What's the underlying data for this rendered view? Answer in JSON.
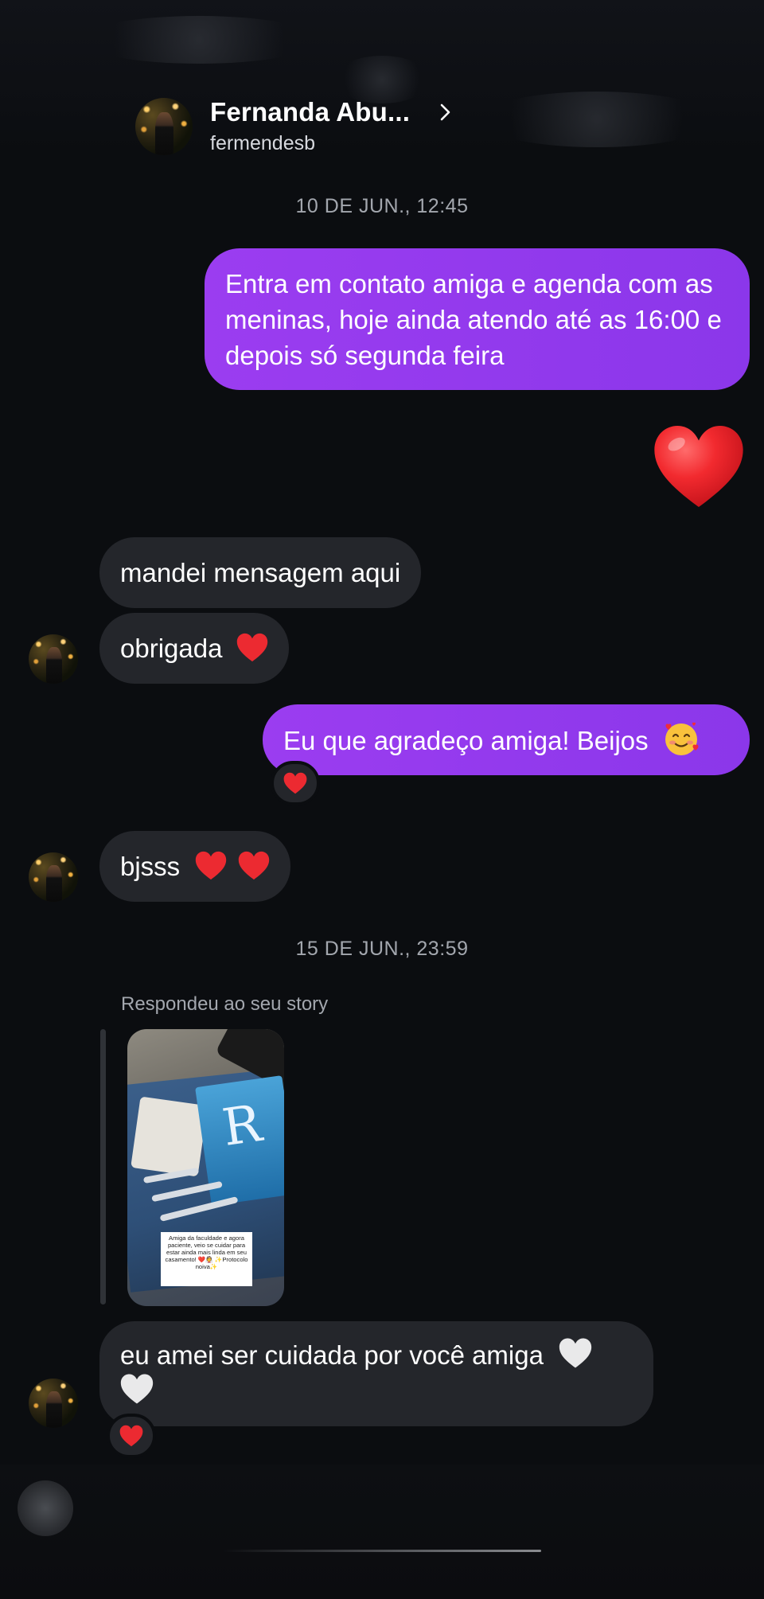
{
  "header": {
    "name": "Fernanda Abu...",
    "handle": "fermendesb"
  },
  "messages": {
    "date1": "10 DE JUN., 12:45",
    "out1": "Entra em contato amiga e agenda com as meninas, hoje ainda atendo até as 16:00 e depois só segunda feira",
    "in1": "mandei mensagem aqui",
    "in2": "obrigada",
    "out2": "Eu que agradeço amiga! Beijos",
    "in3": "bjsss",
    "date2": "15 DE JUN., 23:59",
    "story_reply_label": "Respondeu ao seu story",
    "story_card_text": "Amiga da faculdade e agora paciente, veio se cuidar para estar ainda mais linda em seu casamento! ❤️👰 ✨Protocolo noiva✨",
    "story_box_text": "R",
    "in4": "eu amei ser cuidada por você amiga"
  },
  "colors": {
    "background": "#0b0d10",
    "outgoing_bubble": "#9b3df0",
    "incoming_bubble": "#24262b",
    "heart": "#e8242b",
    "white_heart": "#e9e9ea"
  },
  "icons": {
    "chevron": "chevron-right-icon",
    "heart": "heart-icon",
    "white_heart": "white-heart-icon",
    "smiling_face_with_hearts": "smiling-face-with-hearts-icon"
  }
}
